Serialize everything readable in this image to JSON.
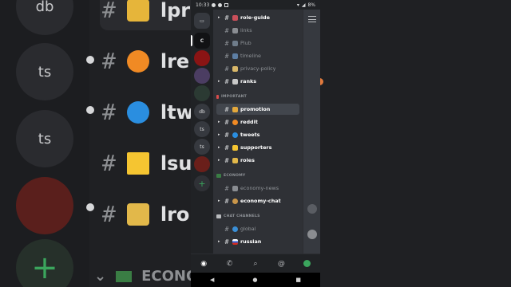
{
  "status": {
    "time": "10:33",
    "battery": "8%"
  },
  "background": {
    "servers": [
      "db",
      "ts",
      "ts"
    ],
    "rows": [
      {
        "text": "lpr"
      },
      {
        "text": "lre"
      },
      {
        "text": "ltw"
      },
      {
        "text": "lsu"
      },
      {
        "text": "lro"
      }
    ],
    "category": "ECONO"
  },
  "rail": {
    "servers": [
      "db",
      "ts",
      "ts"
    ]
  },
  "channels": [
    {
      "name": "role-guide",
      "bright": true,
      "arrow": true
    },
    {
      "name": "links",
      "bright": false,
      "arrow": false
    },
    {
      "name": "Plub",
      "bright": false,
      "arrow": false
    },
    {
      "name": "timeline",
      "bright": false,
      "arrow": false
    },
    {
      "name": "privacy-policy",
      "bright": false,
      "arrow": false
    },
    {
      "name": "ranks",
      "bright": true,
      "arrow": true
    }
  ],
  "categories": {
    "important": "IMPORTANT",
    "economy": "ECONOMY",
    "chat": "CHAT CHANNELS"
  },
  "important_channels": [
    {
      "name": "promotion",
      "bright": true,
      "arrow": false,
      "selected": true
    },
    {
      "name": "reddit",
      "bright": true,
      "arrow": true
    },
    {
      "name": "tweets",
      "bright": true,
      "arrow": true
    },
    {
      "name": "supporters",
      "bright": true,
      "arrow": true
    },
    {
      "name": "roles",
      "bright": true,
      "arrow": true
    }
  ],
  "economy_channels": [
    {
      "name": "economy-news",
      "bright": false,
      "arrow": false
    },
    {
      "name": "economy-chat",
      "bright": true,
      "arrow": true
    }
  ],
  "chat_channels": [
    {
      "name": "global",
      "bright": false,
      "arrow": false
    },
    {
      "name": "russian",
      "bright": true,
      "arrow": true
    }
  ],
  "colors": {
    "accent_green": "#3ba55d",
    "rail_bg": "#202225",
    "channel_bg": "#2f3136",
    "selected_bg": "#42464d"
  }
}
